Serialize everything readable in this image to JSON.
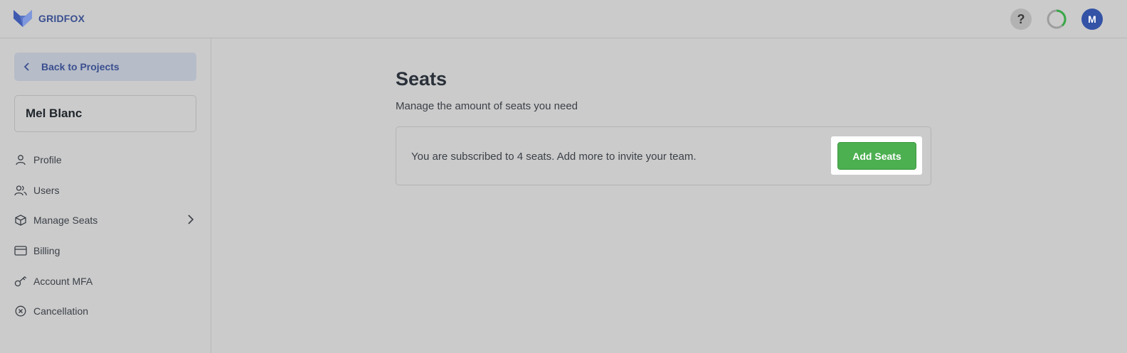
{
  "app": {
    "brand": "GRIDFOX",
    "brand_color": "#3a4f8f"
  },
  "header": {
    "help_label": "?",
    "avatar_initial": "M",
    "avatar_color": "#3453a6"
  },
  "sidebar": {
    "back_label": "Back to Projects",
    "account_name": "Mel Blanc",
    "items": [
      {
        "label": "Profile",
        "icon": "person-icon"
      },
      {
        "label": "Users",
        "icon": "users-icon"
      },
      {
        "label": "Manage Seats",
        "icon": "box-icon",
        "has_submenu": true
      },
      {
        "label": "Billing",
        "icon": "credit-card-icon"
      },
      {
        "label": "Account MFA",
        "icon": "key-icon"
      },
      {
        "label": "Cancellation",
        "icon": "x-circle-icon"
      }
    ]
  },
  "main": {
    "title": "Seats",
    "subtitle": "Manage the amount of seats you need",
    "subscription_text": "You are subscribed to 4 seats. Add more to invite your team.",
    "add_button_label": "Add Seats",
    "button_color": "#4caf50"
  }
}
